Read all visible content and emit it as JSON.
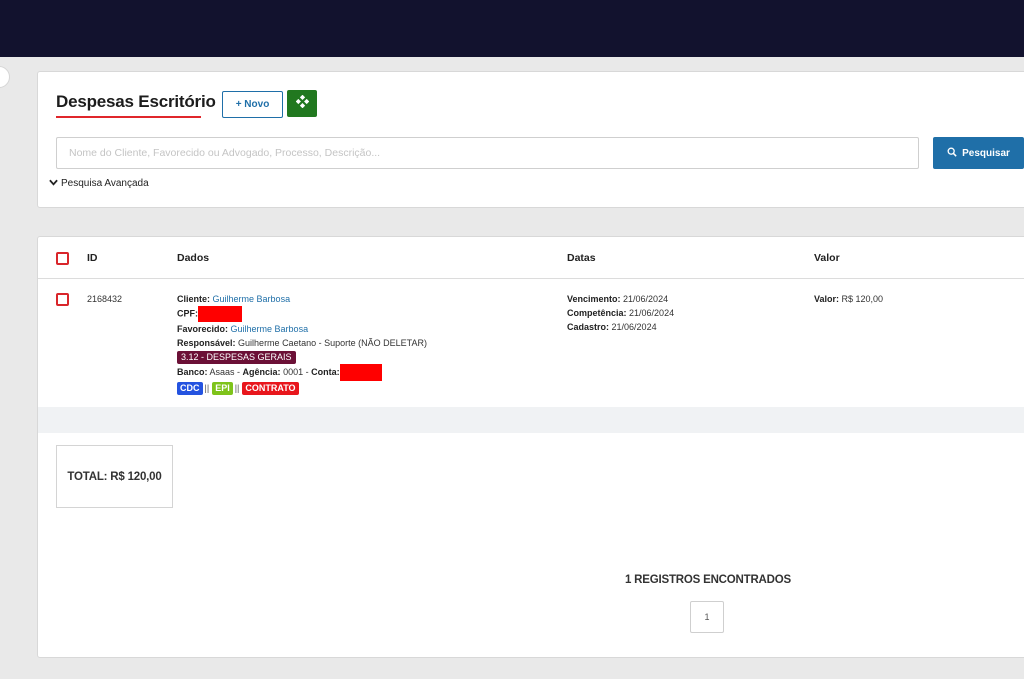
{
  "header": {
    "title": "Despesas Escritório"
  },
  "toolbar": {
    "new_label": "+ Novo",
    "extra_icon": "diamond-grid-icon",
    "accent": "#21781f"
  },
  "search": {
    "placeholder": "Nome do Cliente, Favorecido ou Advogado, Processo, Descrição...",
    "value": "",
    "button_label": "Pesquisar",
    "advanced_label": "Pesquisa Avançada"
  },
  "table": {
    "columns": {
      "id": "ID",
      "dados": "Dados",
      "datas": "Datas",
      "valor": "Valor"
    },
    "rows": [
      {
        "id": "2168432",
        "cliente_label": "Cliente:",
        "cliente": "Guilherme Barbosa",
        "cpf_label": "CPF:",
        "favorecido_label": "Favorecido:",
        "favorecido": "Guilherme Barbosa",
        "responsavel_label": "Responsável:",
        "responsavel": "Guilherme Caetano - Suporte (NÃO DELETAR)",
        "categoria": "3.12 - DESPESAS GERAIS",
        "banco_label": "Banco:",
        "banco": "Asaas",
        "agencia_label": "Agência:",
        "agencia": "0001",
        "conta_label": "Conta:",
        "tags": [
          {
            "label": "CDC",
            "color": "#2453e0"
          },
          {
            "label": "EPI",
            "color": "#7ec31a"
          },
          {
            "label": "CONTRATO",
            "color": "#e8161c"
          }
        ],
        "separator": "||",
        "vencimento_label": "Vencimento:",
        "vencimento": "21/06/2024",
        "competencia_label": "Competência:",
        "competencia": "21/06/2024",
        "cadastro_label": "Cadastro:",
        "cadastro": "21/06/2024",
        "valor_label": "Valor:",
        "valor": "R$ 120,00"
      }
    ]
  },
  "summary": {
    "total_label": "TOTAL: R$ 120,00",
    "records_label": "1 REGISTROS ENCONTRADOS"
  },
  "pagination": {
    "current": "1"
  },
  "colors": {
    "topbar": "#12122e",
    "primary": "#1f6fa8",
    "danger": "#e0262b",
    "category": "#6b1036"
  }
}
